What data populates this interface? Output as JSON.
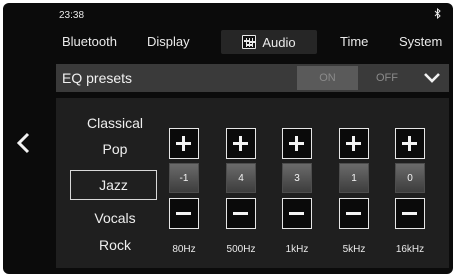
{
  "status": {
    "time": "23:38",
    "bluetooth_icon": "bluetooth-icon"
  },
  "tabs": [
    {
      "label": "Bluetooth"
    },
    {
      "label": "Display"
    },
    {
      "label": "Audio",
      "icon": "equalizer-icon",
      "active": true
    },
    {
      "label": "Time"
    },
    {
      "label": "System"
    }
  ],
  "eq_presets": {
    "title": "EQ presets",
    "toggle": {
      "on_label": "ON",
      "off_label": "OFF",
      "selected": "ON"
    },
    "expand_icon": "chevron-down-icon"
  },
  "presets": [
    {
      "label": "Classical"
    },
    {
      "label": "Pop"
    },
    {
      "label": "Jazz",
      "selected": true
    },
    {
      "label": "Vocals"
    },
    {
      "label": "Rock"
    }
  ],
  "bands": [
    {
      "freq": "80Hz",
      "value": "-1"
    },
    {
      "freq": "500Hz",
      "value": "4"
    },
    {
      "freq": "1kHz",
      "value": "3"
    },
    {
      "freq": "5kHz",
      "value": "1"
    },
    {
      "freq": "16kHz",
      "value": "0"
    }
  ],
  "nav": {
    "back_icon": "chevron-left-icon"
  },
  "colors": {
    "background": "#0b0b0b",
    "panel": "#1f1f1f",
    "header_bar": "#3a3a3a",
    "toggle_active": "#5a5a5a"
  }
}
